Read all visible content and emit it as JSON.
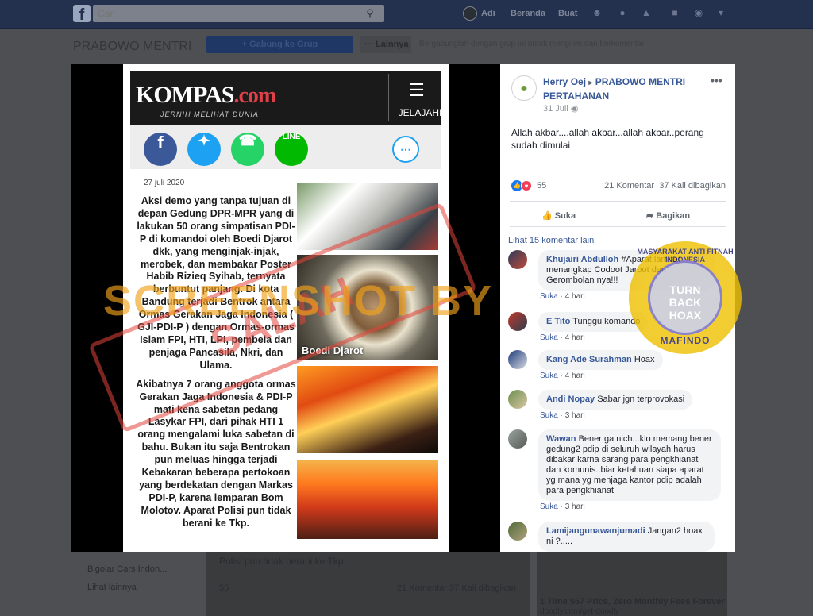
{
  "topbar": {
    "search_placeholder": "Cari",
    "user_name": "Adi",
    "home_label": "Beranda",
    "create_label": "Buat"
  },
  "background_page": {
    "group_title": "PRABOWO MENTRI",
    "join_button": "+ Gabung ke Grup",
    "more_button": "··· Lainnya",
    "description": "Bergabunglah dengan grup ini untuk mengirim dan berkomentar",
    "bottom_text": "Polisi pun tidak berani ke Tkp.",
    "likes_count": "55",
    "stats": "21 Komentar  37 Kali dibagikan",
    "side_item": "Bigolar Cars Indon...",
    "side_more": "Lihat lainnya",
    "ad_text": "1 Time $67 Price, Zero Monthly Fees Forever",
    "ad_url": "doodly.com/get-doodly"
  },
  "poster": {
    "kompas_name": "KOMPAS",
    "kompas_domain": ".com",
    "kompas_tagline": "JERNIH MELIHAT DUNIA",
    "jelajahi_label": "JELAJAHI",
    "date": "27 juli 2020",
    "paragraph_1": "Aksi demo yang tanpa tujuan di depan Gedung DPR-MPR yang di lakukan 50 orang simpatisan PDI-P di komandoi oleh Boedi Djarot dkk, yang menginjak-injak, merobek, dan membakar Poster Habib Rizieq Syihab, ternyata berbuntut panjang. Di kota Bandung terjadi Bentrok antara Ormas Gerakan Jaga Indonesia ( GJI-PDI-P ) dengan Ormas-ormas Islam FPI, HTI, LPI, pembela dan penjaga Pancasila, Nkri, dan Ulama.",
    "paragraph_2": "Akibatnya 7 orang anggota ormas Gerakan Jaga Indonesia & PDI-P mati kena sabetan pedang Lasykar FPI, dari pihak HTI 1 orang mengalami luka sabetan di bahu. Bukan itu saja Bentrokan pun meluas hingga terjadi Kebakaran beberapa pertokoan yang berdekatan dengan Markas PDI-P, karena lemparan Bom Molotov. Aparat Polisi pun tidak berani ke Tkp.",
    "photo2_caption": "Boedi Djarot"
  },
  "watermarks": {
    "screenshot_by": "SCREENSHOT BY",
    "salah": "SALAH",
    "mafindo_top": "MASYARAKAT ANTI FITNAH INDONESIA",
    "mafindo_center_1": "TURN",
    "mafindo_center_2": "BACK",
    "mafindo_center_3": "HOAX",
    "mafindo_bottom": "MAFINDO"
  },
  "post": {
    "author": "Herry Oej",
    "group": "PRABOWO MENTRI PERTAHANAN",
    "time": "31 Juli",
    "text": "Allah akbar....allah akbar...allah akbar..perang sudah dimulai",
    "likes_count": "55",
    "comments_count": "21 Komentar",
    "shares_count": "37 Kali dibagikan",
    "like_label": "Suka",
    "share_label": "Bagikan",
    "more_comments": "Lihat 15 komentar lain"
  },
  "comments": [
    {
      "name": "Khujairi Abdulloh",
      "text": "#Aparat lambat menangkap Codoot Jaroot dan Gerombolan nya!!!",
      "like": "Suka",
      "time": "4 hari"
    },
    {
      "name": "E Tito",
      "text": "Tunggu komando",
      "like": "Suka",
      "time": "4 hari"
    },
    {
      "name": "Kang Ade Surahman",
      "text": "Hoax",
      "like": "Suka",
      "time": "4 hari"
    },
    {
      "name": "Andi Nopay",
      "text": "Sabar jgn terprovokasi",
      "like": "Suka",
      "time": "3 hari"
    },
    {
      "name": "Wawan",
      "text": "Bener ga nich...klo memang bener gedung2 pdip di seluruh wilayah harus dibakar karna sarang para pengkhianat dan komunis..biar ketahuan siapa aparat yg mana yg menjaga kantor pdip adalah para pengkhianat",
      "like": "Suka",
      "time": "3 hari"
    },
    {
      "name": "Lamijangunawanjumadi",
      "text": "Jangan2 hoax ni ?....."
    }
  ],
  "colors": {
    "facebook_blue": "#385898",
    "topbar_dark": "#23314f",
    "stamp_red": "#e4443b",
    "watermark_orange": "#f2a21c",
    "mafindo_yellow": "#f5c800"
  }
}
